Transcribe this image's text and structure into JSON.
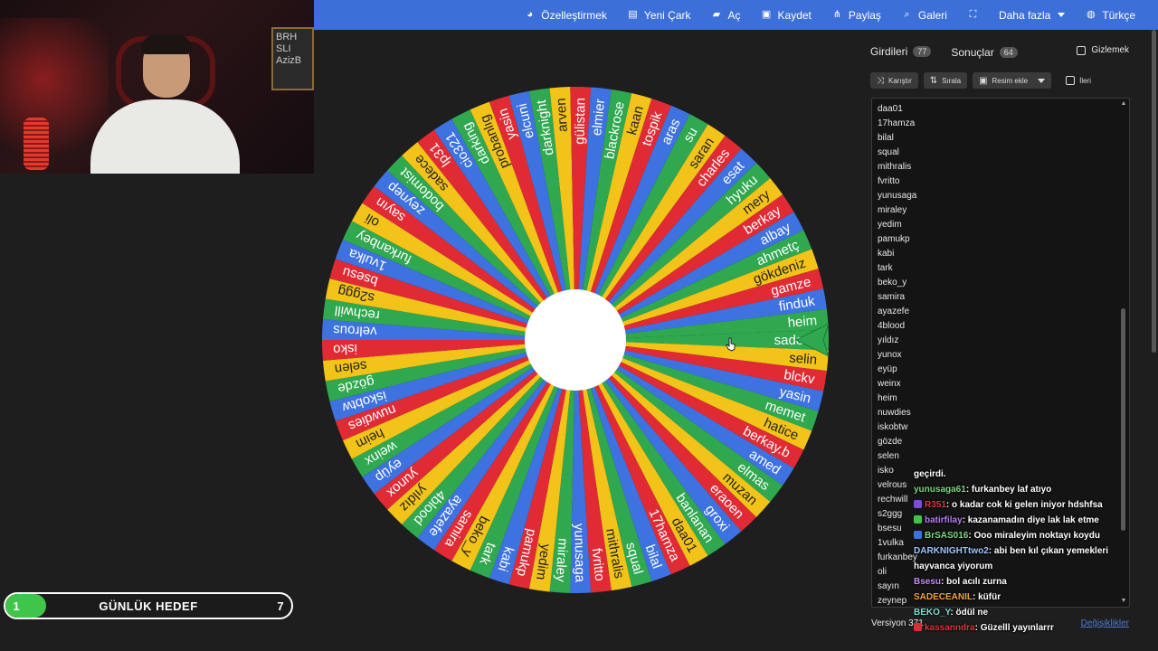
{
  "topbar": {
    "items": [
      {
        "label": "Özelleştirmek",
        "icon": "palette-icon"
      },
      {
        "label": "Yeni Çark",
        "icon": "file-icon"
      },
      {
        "label": "Aç",
        "icon": "folder-icon"
      },
      {
        "label": "Kaydet",
        "icon": "save-icon"
      },
      {
        "label": "Paylaş",
        "icon": "share-icon"
      },
      {
        "label": "Galeri",
        "icon": "search-icon"
      },
      {
        "label": "",
        "icon": "fullscreen-icon"
      },
      {
        "label": "Daha fazla",
        "icon": "",
        "dropdown": true
      },
      {
        "label": "Türkçe",
        "icon": "globe-icon"
      }
    ]
  },
  "webcam": {
    "board_text": "BRH\nSLI\nAzizB"
  },
  "goal": {
    "start": "1",
    "label": "GÜNLÜK HEDEF",
    "end": "7",
    "progress": 0.14,
    "color": "#3fc64a"
  },
  "wheel": {
    "colors": [
      "#2fa84f",
      "#f2c318",
      "#e02b35",
      "#3d72e0"
    ],
    "segments": [
      "sadece",
      "selin",
      "blckv",
      "yasin",
      "memet",
      "hatice",
      "berkay.b",
      "amed",
      "elmas",
      "muzan",
      "eraoen",
      "groxi",
      "banlanan",
      "daa01",
      "17hamza",
      "bilal",
      "squal",
      "mithralis",
      "fvritto",
      "yunusaga",
      "miraley",
      "yedim",
      "pamukp",
      "kabi",
      "tark",
      "beko_y",
      "samira",
      "ayazefe",
      "4blood",
      "yıldız",
      "yunox",
      "eyüp",
      "weinx",
      "heim",
      "nuwdies",
      "iskobtw",
      "gözde",
      "selen",
      "isko",
      "velrous",
      "rechwill",
      "s2ggg",
      "bsesu",
      "1vulka",
      "furkanbey",
      "oli",
      "sayın",
      "zeynep",
      "bodomist",
      "sadece",
      "lp31",
      "cio321",
      "darking",
      "probanlıg",
      "yasin",
      "elcuni",
      "darknight",
      "arven",
      "gülistan",
      "elmier",
      "blackrose",
      "kaan",
      "tospik",
      "aras",
      "su",
      "saran",
      "charles",
      "esat",
      "hyuku",
      "mery",
      "berkay",
      "albay",
      "ahmetç",
      "gökdeniz",
      "gamze",
      "finduk",
      "heim"
    ],
    "pointer_color": "#2fa84f"
  },
  "panel": {
    "tabs": [
      {
        "label": "Girdileri",
        "count": "77"
      },
      {
        "label": "Sonuçlar",
        "count": "64"
      }
    ],
    "hide_label": "Gizlemek",
    "toolbar": {
      "shuffle": "Karıştır",
      "sort": "Sırala",
      "add_image": "Resim ekle",
      "advanced": "İleri"
    },
    "entries": [
      "daa01",
      "17hamza",
      "bilal",
      "squal",
      "mithralis",
      "fvritto",
      "yunusaga",
      "miraley",
      "yedim",
      "pamukp",
      "kabi",
      "tark",
      "beko_y",
      "samira",
      "ayazefe",
      "4blood",
      "yıldız",
      "yunox",
      "eyüp",
      "weinx",
      "heim",
      "nuwdies",
      "iskobtw",
      "gözde",
      "selen",
      "isko",
      "velrous",
      "rechwill",
      "s2ggg",
      "bsesu",
      "1vulka",
      "furkanbey",
      "oli",
      "sayın",
      "zeynep"
    ],
    "version": "Versiyon 371",
    "changes": "Değişiklikler"
  },
  "chat": [
    {
      "user": "",
      "user_color": "#ffffff",
      "text": "geçirdi.",
      "badge": ""
    },
    {
      "user": "yunusaga61",
      "user_color": "#7fd47f",
      "text": ": furkanbey laf atıyo",
      "badge": ""
    },
    {
      "user": "R351",
      "user_color": "#d9363e",
      "text": ": o kadar cok ki gelen iniyor hdshfsa",
      "badge": "#7a4fd6"
    },
    {
      "user": "batirfilay",
      "user_color": "#b87df0",
      "text": ": kazanamadın diye lak lak etme",
      "badge": "#3fc64a"
    },
    {
      "user": "BrSAS016",
      "user_color": "#7fd47f",
      "text": ": Ooo miraleyim noktayı koydu",
      "badge": "#3d72e0"
    },
    {
      "user": "DARKNIGHTtwo2",
      "user_color": "#9fc6ff",
      "text": ": abi ben kıl çıkan yemekleri hayvanca yiyorum",
      "badge": ""
    },
    {
      "user": "Bsesu",
      "user_color": "#c38cf5",
      "text": ": bol acılı zurna",
      "badge": ""
    },
    {
      "user": "SADECEANIL",
      "user_color": "#f2a33a",
      "text": ": küfür",
      "badge": ""
    },
    {
      "user": "BEKO_Y",
      "user_color": "#7fe0d6",
      "text": ": ödül ne",
      "badge": ""
    },
    {
      "user": "kassanndra",
      "user_color": "#d9363e",
      "text": ": Güzelll yayınlarrr",
      "badge": "#e02b35"
    }
  ]
}
